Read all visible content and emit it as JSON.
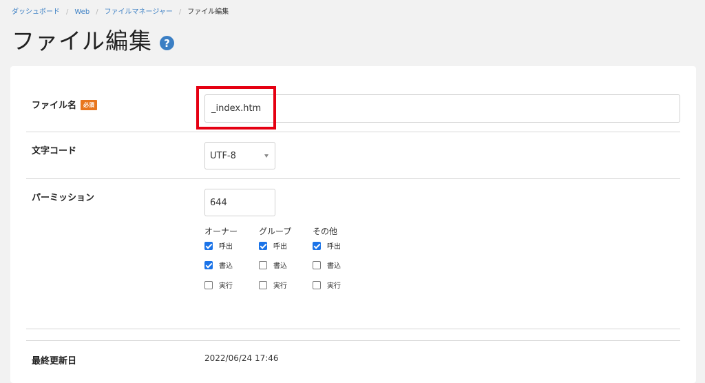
{
  "breadcrumb": {
    "items": [
      "ダッシュボード",
      "Web",
      "ファイルマネージャー"
    ],
    "current": "ファイル編集",
    "separator": "/"
  },
  "page": {
    "title": "ファイル編集",
    "help_icon": "?"
  },
  "form": {
    "filename": {
      "label": "ファイル名",
      "required_badge": "必須",
      "value": "_index.htm"
    },
    "encoding": {
      "label": "文字コード",
      "selected": "UTF-8"
    },
    "permission": {
      "label": "パーミッション",
      "value": "644",
      "groups": [
        {
          "name": "オーナー",
          "read": {
            "label": "呼出",
            "checked": true
          },
          "write": {
            "label": "書込",
            "checked": true
          },
          "exec": {
            "label": "実行",
            "checked": false
          }
        },
        {
          "name": "グループ",
          "read": {
            "label": "呼出",
            "checked": true
          },
          "write": {
            "label": "書込",
            "checked": false
          },
          "exec": {
            "label": "実行",
            "checked": false
          }
        },
        {
          "name": "その他",
          "read": {
            "label": "呼出",
            "checked": true
          },
          "write": {
            "label": "書込",
            "checked": false
          },
          "exec": {
            "label": "実行",
            "checked": false
          }
        }
      ]
    },
    "last_modified": {
      "label": "最終更新日",
      "value": "2022/06/24 17:46"
    }
  },
  "colors": {
    "accent": "#3b7fc4",
    "required": "#e8761e",
    "highlight": "#e50012",
    "checkbox": "#1a73e8"
  }
}
